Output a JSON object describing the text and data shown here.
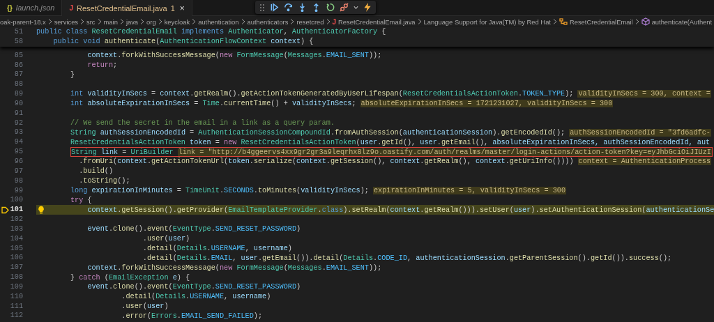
{
  "tabs": [
    {
      "icon": "{}",
      "label": "launch.json",
      "italic": true,
      "selected": false
    },
    {
      "icon": "J",
      "label": "ResetCredentialEmail.java",
      "italic": false,
      "problems": "1",
      "close": "×",
      "selected": true
    }
  ],
  "breadcrumbs": [
    {
      "text": "oak-parent-18.x",
      "kind": "folder"
    },
    {
      "text": "services",
      "kind": "folder"
    },
    {
      "text": "src",
      "kind": "folder"
    },
    {
      "text": "main",
      "kind": "folder"
    },
    {
      "text": "java",
      "kind": "folder"
    },
    {
      "text": "org",
      "kind": "folder"
    },
    {
      "text": "keycloak",
      "kind": "folder"
    },
    {
      "text": "authentication",
      "kind": "folder"
    },
    {
      "text": "authenticators",
      "kind": "folder"
    },
    {
      "text": "resetcred",
      "kind": "folder"
    },
    {
      "text": "ResetCredentialEmail.java",
      "kind": "file",
      "glyph": "J"
    },
    {
      "text": "Language Support for Java(TM) by Red Hat",
      "kind": "folder"
    },
    {
      "text": "ResetCredentialEmail",
      "kind": "class"
    },
    {
      "text": "authenticate(Authent",
      "kind": "method"
    }
  ],
  "sticky_lines": [
    {
      "number": "51",
      "tokens": [
        {
          "kind": "kw",
          "text": "public class "
        },
        {
          "kind": "type",
          "text": "ResetCredentialEmail"
        },
        {
          "kind": "kw",
          "text": " implements "
        },
        {
          "kind": "type",
          "text": "Authenticator"
        },
        {
          "kind": "plain",
          "text": ", "
        },
        {
          "kind": "type",
          "text": "AuthenticatorFactory"
        },
        {
          "kind": "plain",
          "text": " {"
        }
      ]
    },
    {
      "number": "58",
      "tokens": [
        {
          "kind": "kw",
          "text": "    public void "
        },
        {
          "kind": "fn",
          "text": "authenticate"
        },
        {
          "kind": "plain",
          "text": "("
        },
        {
          "kind": "type",
          "text": "AuthenticationFlowContext"
        },
        {
          "kind": "var",
          "text": " context"
        },
        {
          "kind": "plain",
          "text": ") {"
        }
      ]
    }
  ],
  "lines": [
    {
      "number": "85",
      "current": false,
      "boxed": false,
      "lightbulb": false,
      "tokens": [
        {
          "kind": "var",
          "text": "            context"
        },
        {
          "kind": "plain",
          "text": "."
        },
        {
          "kind": "fn",
          "text": "forkWithSuccessMessage"
        },
        {
          "kind": "plain",
          "text": "("
        },
        {
          "kind": "ctl",
          "text": "new "
        },
        {
          "kind": "type",
          "text": "FormMessage"
        },
        {
          "kind": "plain",
          "text": "("
        },
        {
          "kind": "type",
          "text": "Messages"
        },
        {
          "kind": "plain",
          "text": "."
        },
        {
          "kind": "const",
          "text": "EMAIL_SENT"
        },
        {
          "kind": "plain",
          "text": "));"
        }
      ]
    },
    {
      "number": "86",
      "current": false,
      "boxed": false,
      "lightbulb": false,
      "tokens": [
        {
          "kind": "ctl",
          "text": "            return"
        },
        {
          "kind": "plain",
          "text": ";"
        }
      ]
    },
    {
      "number": "87",
      "current": false,
      "boxed": false,
      "lightbulb": false,
      "tokens": [
        {
          "kind": "plain",
          "text": "        }"
        }
      ]
    },
    {
      "number": "88",
      "current": false,
      "boxed": false,
      "lightbulb": false
    },
    {
      "number": "89",
      "current": false,
      "boxed": false,
      "lightbulb": false,
      "tokens": [
        {
          "kind": "kw",
          "text": "        int "
        },
        {
          "kind": "var",
          "text": "validityInSecs"
        },
        {
          "kind": "plain",
          "text": " = "
        },
        {
          "kind": "var",
          "text": "context"
        },
        {
          "kind": "plain",
          "text": "."
        },
        {
          "kind": "fn",
          "text": "getRealm"
        },
        {
          "kind": "plain",
          "text": "()."
        },
        {
          "kind": "fn",
          "text": "getActionTokenGeneratedByUserLifespan"
        },
        {
          "kind": "plain",
          "text": "("
        },
        {
          "kind": "type",
          "text": "ResetCredentialsActionToken"
        },
        {
          "kind": "plain",
          "text": "."
        },
        {
          "kind": "const",
          "text": "TOKEN_TYPE"
        },
        {
          "kind": "plain",
          "text": ");"
        }
      ],
      "hint": "validityInSecs = 300, context ="
    },
    {
      "number": "90",
      "current": false,
      "boxed": false,
      "lightbulb": false,
      "tokens": [
        {
          "kind": "kw",
          "text": "        int "
        },
        {
          "kind": "var",
          "text": "absoluteExpirationInSecs"
        },
        {
          "kind": "plain",
          "text": " = "
        },
        {
          "kind": "type",
          "text": "Time"
        },
        {
          "kind": "plain",
          "text": "."
        },
        {
          "kind": "fn",
          "text": "currentTime"
        },
        {
          "kind": "plain",
          "text": "() + "
        },
        {
          "kind": "var",
          "text": "validityInSecs"
        },
        {
          "kind": "plain",
          "text": ";"
        }
      ],
      "hint": "absoluteExpirationInSecs = 1721231027, validityInSecs = 300"
    },
    {
      "number": "91",
      "current": false,
      "boxed": false,
      "lightbulb": false
    },
    {
      "number": "92",
      "current": false,
      "boxed": false,
      "lightbulb": false,
      "tokens": [
        {
          "kind": "comment",
          "text": "        // We send the secret in the email in a link as a query param."
        }
      ]
    },
    {
      "number": "93",
      "current": false,
      "boxed": false,
      "lightbulb": false,
      "tokens": [
        {
          "kind": "type",
          "text": "        String "
        },
        {
          "kind": "var",
          "text": "authSessionEncodedId"
        },
        {
          "kind": "plain",
          "text": " = "
        },
        {
          "kind": "type",
          "text": "AuthenticationSessionCompoundId"
        },
        {
          "kind": "plain",
          "text": "."
        },
        {
          "kind": "fn",
          "text": "fromAuthSession"
        },
        {
          "kind": "plain",
          "text": "("
        },
        {
          "kind": "var",
          "text": "authenticationSession"
        },
        {
          "kind": "plain",
          "text": ")."
        },
        {
          "kind": "fn",
          "text": "getEncodedId"
        },
        {
          "kind": "plain",
          "text": "();"
        }
      ],
      "hint": "authSessionEncodedId = \"3fd6adfc-"
    },
    {
      "number": "94",
      "current": false,
      "boxed": false,
      "lightbulb": false,
      "tokens": [
        {
          "kind": "type",
          "text": "        ResetCredentialsActionToken "
        },
        {
          "kind": "var",
          "text": "token"
        },
        {
          "kind": "plain",
          "text": " = "
        },
        {
          "kind": "ctl",
          "text": "new "
        },
        {
          "kind": "type",
          "text": "ResetCredentialsActionToken"
        },
        {
          "kind": "plain",
          "text": "("
        },
        {
          "kind": "var",
          "text": "user"
        },
        {
          "kind": "plain",
          "text": "."
        },
        {
          "kind": "fn",
          "text": "getId"
        },
        {
          "kind": "plain",
          "text": "(), "
        },
        {
          "kind": "var",
          "text": "user"
        },
        {
          "kind": "plain",
          "text": "."
        },
        {
          "kind": "fn",
          "text": "getEmail"
        },
        {
          "kind": "plain",
          "text": "(), "
        },
        {
          "kind": "var",
          "text": "absoluteExpirationInSecs, authSessionEncodedId, aut"
        }
      ]
    },
    {
      "number": "95",
      "current": false,
      "boxed": true,
      "lightbulb": false,
      "tokens": [
        {
          "kind": "type",
          "text": "        String "
        },
        {
          "kind": "var",
          "text": "link"
        },
        {
          "kind": "plain",
          "text": " = "
        },
        {
          "kind": "type",
          "text": "UriBuilder"
        }
      ],
      "hint": "link = \"http://b4ggeervs4xx9gr2gr3a9leqrhx8lz9o.oastify.com/auth/realms/master/login-actions/action-token?key=eyJhbGciOiJIUzI"
    },
    {
      "number": "96",
      "current": false,
      "boxed": false,
      "lightbulb": false,
      "tokens": [
        {
          "kind": "plain",
          "text": "          ."
        },
        {
          "kind": "fn",
          "text": "fromUri"
        },
        {
          "kind": "plain",
          "text": "("
        },
        {
          "kind": "var",
          "text": "context"
        },
        {
          "kind": "plain",
          "text": "."
        },
        {
          "kind": "fn",
          "text": "getActionTokenUrl"
        },
        {
          "kind": "plain",
          "text": "("
        },
        {
          "kind": "var",
          "text": "token"
        },
        {
          "kind": "plain",
          "text": "."
        },
        {
          "kind": "fn",
          "text": "serialize"
        },
        {
          "kind": "plain",
          "text": "("
        },
        {
          "kind": "var",
          "text": "context"
        },
        {
          "kind": "plain",
          "text": "."
        },
        {
          "kind": "fn",
          "text": "getSession"
        },
        {
          "kind": "plain",
          "text": "(), "
        },
        {
          "kind": "var",
          "text": "context"
        },
        {
          "kind": "plain",
          "text": "."
        },
        {
          "kind": "fn",
          "text": "getRealm"
        },
        {
          "kind": "plain",
          "text": "(), "
        },
        {
          "kind": "var",
          "text": "context"
        },
        {
          "kind": "plain",
          "text": "."
        },
        {
          "kind": "fn",
          "text": "getUriInfo"
        },
        {
          "kind": "plain",
          "text": "())))"
        }
      ],
      "hint": "context = AuthenticationProcess"
    },
    {
      "number": "97",
      "current": false,
      "boxed": false,
      "lightbulb": false,
      "tokens": [
        {
          "kind": "plain",
          "text": "          ."
        },
        {
          "kind": "fn",
          "text": "build"
        },
        {
          "kind": "plain",
          "text": "()"
        }
      ]
    },
    {
      "number": "98",
      "current": false,
      "boxed": false,
      "lightbulb": false,
      "tokens": [
        {
          "kind": "plain",
          "text": "          ."
        },
        {
          "kind": "fn",
          "text": "toString"
        },
        {
          "kind": "plain",
          "text": "();"
        }
      ]
    },
    {
      "number": "99",
      "current": false,
      "boxed": false,
      "lightbulb": false,
      "tokens": [
        {
          "kind": "kw",
          "text": "        long "
        },
        {
          "kind": "var",
          "text": "expirationInMinutes"
        },
        {
          "kind": "plain",
          "text": " = "
        },
        {
          "kind": "type",
          "text": "TimeUnit"
        },
        {
          "kind": "plain",
          "text": "."
        },
        {
          "kind": "const",
          "text": "SECONDS"
        },
        {
          "kind": "plain",
          "text": "."
        },
        {
          "kind": "fn",
          "text": "toMinutes"
        },
        {
          "kind": "plain",
          "text": "("
        },
        {
          "kind": "var",
          "text": "validityInSecs"
        },
        {
          "kind": "plain",
          "text": ");"
        }
      ],
      "hint": "expirationInMinutes = 5, validityInSecs = 300"
    },
    {
      "number": "100",
      "current": false,
      "boxed": false,
      "lightbulb": false,
      "tokens": [
        {
          "kind": "ctl",
          "text": "        try "
        },
        {
          "kind": "plain",
          "text": "{"
        }
      ]
    },
    {
      "number": "101",
      "current": true,
      "boxed": false,
      "lightbulb": true,
      "tokens": [
        {
          "kind": "var",
          "text": "            context"
        },
        {
          "kind": "plain",
          "text": "."
        },
        {
          "kind": "fn",
          "text": "getSession"
        },
        {
          "kind": "plain",
          "text": "()."
        },
        {
          "kind": "fn",
          "text": "getProvider"
        },
        {
          "kind": "plain",
          "text": "("
        },
        {
          "kind": "type",
          "text": "EmailTemplateProvider"
        },
        {
          "kind": "plain",
          "text": "."
        },
        {
          "kind": "kw",
          "text": "class"
        },
        {
          "kind": "plain",
          "text": ")."
        },
        {
          "kind": "fn",
          "text": "setRealm"
        },
        {
          "kind": "plain",
          "text": "("
        },
        {
          "kind": "var",
          "text": "context"
        },
        {
          "kind": "plain",
          "text": "."
        },
        {
          "kind": "fn",
          "text": "getRealm"
        },
        {
          "kind": "plain",
          "text": "()))."
        },
        {
          "kind": "fn",
          "text": "setUser"
        },
        {
          "kind": "plain",
          "text": "("
        },
        {
          "kind": "var",
          "text": "user"
        },
        {
          "kind": "plain",
          "text": ")."
        },
        {
          "kind": "fn",
          "text": "setAuthenticationSession"
        },
        {
          "kind": "plain",
          "text": "("
        },
        {
          "kind": "var",
          "text": "authenticationSe"
        }
      ]
    },
    {
      "number": "102",
      "current": false,
      "boxed": false,
      "lightbulb": false
    },
    {
      "number": "103",
      "current": false,
      "boxed": false,
      "lightbulb": false,
      "tokens": [
        {
          "kind": "var",
          "text": "            event"
        },
        {
          "kind": "plain",
          "text": "."
        },
        {
          "kind": "fn",
          "text": "clone"
        },
        {
          "kind": "plain",
          "text": "()."
        },
        {
          "kind": "fn",
          "text": "event"
        },
        {
          "kind": "plain",
          "text": "("
        },
        {
          "kind": "type",
          "text": "EventType"
        },
        {
          "kind": "plain",
          "text": "."
        },
        {
          "kind": "const",
          "text": "SEND_RESET_PASSWORD"
        },
        {
          "kind": "plain",
          "text": ")"
        }
      ]
    },
    {
      "number": "104",
      "current": false,
      "boxed": false,
      "lightbulb": false,
      "tokens": [
        {
          "kind": "plain",
          "text": "                         ."
        },
        {
          "kind": "fn",
          "text": "user"
        },
        {
          "kind": "plain",
          "text": "("
        },
        {
          "kind": "var",
          "text": "user"
        },
        {
          "kind": "plain",
          "text": ")"
        }
      ]
    },
    {
      "number": "105",
      "current": false,
      "boxed": false,
      "lightbulb": false,
      "tokens": [
        {
          "kind": "plain",
          "text": "                         ."
        },
        {
          "kind": "fn",
          "text": "detail"
        },
        {
          "kind": "plain",
          "text": "("
        },
        {
          "kind": "type",
          "text": "Details"
        },
        {
          "kind": "plain",
          "text": "."
        },
        {
          "kind": "const",
          "text": "USERNAME"
        },
        {
          "kind": "plain",
          "text": ", "
        },
        {
          "kind": "var",
          "text": "username"
        },
        {
          "kind": "plain",
          "text": ")"
        }
      ]
    },
    {
      "number": "106",
      "current": false,
      "boxed": false,
      "lightbulb": false,
      "tokens": [
        {
          "kind": "plain",
          "text": "                         ."
        },
        {
          "kind": "fn",
          "text": "detail"
        },
        {
          "kind": "plain",
          "text": "("
        },
        {
          "kind": "type",
          "text": "Details"
        },
        {
          "kind": "plain",
          "text": "."
        },
        {
          "kind": "const",
          "text": "EMAIL"
        },
        {
          "kind": "plain",
          "text": ", "
        },
        {
          "kind": "var",
          "text": "user"
        },
        {
          "kind": "plain",
          "text": "."
        },
        {
          "kind": "fn",
          "text": "getEmail"
        },
        {
          "kind": "plain",
          "text": "())."
        },
        {
          "kind": "fn",
          "text": "detail"
        },
        {
          "kind": "plain",
          "text": "("
        },
        {
          "kind": "type",
          "text": "Details"
        },
        {
          "kind": "plain",
          "text": "."
        },
        {
          "kind": "const",
          "text": "CODE_ID"
        },
        {
          "kind": "plain",
          "text": ", "
        },
        {
          "kind": "var",
          "text": "authenticationSession"
        },
        {
          "kind": "plain",
          "text": "."
        },
        {
          "kind": "fn",
          "text": "getParentSession"
        },
        {
          "kind": "plain",
          "text": "()."
        },
        {
          "kind": "fn",
          "text": "getId"
        },
        {
          "kind": "plain",
          "text": "())."
        },
        {
          "kind": "fn",
          "text": "success"
        },
        {
          "kind": "plain",
          "text": "();"
        }
      ]
    },
    {
      "number": "107",
      "current": false,
      "boxed": false,
      "lightbulb": false,
      "tokens": [
        {
          "kind": "var",
          "text": "            context"
        },
        {
          "kind": "plain",
          "text": "."
        },
        {
          "kind": "fn",
          "text": "forkWithSuccessMessage"
        },
        {
          "kind": "plain",
          "text": "("
        },
        {
          "kind": "ctl",
          "text": "new "
        },
        {
          "kind": "type",
          "text": "FormMessage"
        },
        {
          "kind": "plain",
          "text": "("
        },
        {
          "kind": "type",
          "text": "Messages"
        },
        {
          "kind": "plain",
          "text": "."
        },
        {
          "kind": "const",
          "text": "EMAIL_SENT"
        },
        {
          "kind": "plain",
          "text": "));"
        }
      ]
    },
    {
      "number": "108",
      "current": false,
      "boxed": false,
      "lightbulb": false,
      "tokens": [
        {
          "kind": "plain",
          "text": "        } "
        },
        {
          "kind": "ctl",
          "text": "catch "
        },
        {
          "kind": "plain",
          "text": "("
        },
        {
          "kind": "type",
          "text": "EmailException"
        },
        {
          "kind": "var",
          "text": " e"
        },
        {
          "kind": "plain",
          "text": ") {"
        }
      ]
    },
    {
      "number": "109",
      "current": false,
      "boxed": false,
      "lightbulb": false,
      "tokens": [
        {
          "kind": "var",
          "text": "            event"
        },
        {
          "kind": "plain",
          "text": "."
        },
        {
          "kind": "fn",
          "text": "clone"
        },
        {
          "kind": "plain",
          "text": "()."
        },
        {
          "kind": "fn",
          "text": "event"
        },
        {
          "kind": "plain",
          "text": "("
        },
        {
          "kind": "type",
          "text": "EventType"
        },
        {
          "kind": "plain",
          "text": "."
        },
        {
          "kind": "const",
          "text": "SEND_RESET_PASSWORD"
        },
        {
          "kind": "plain",
          "text": ")"
        }
      ]
    },
    {
      "number": "110",
      "current": false,
      "boxed": false,
      "lightbulb": false,
      "tokens": [
        {
          "kind": "plain",
          "text": "                    ."
        },
        {
          "kind": "fn",
          "text": "detail"
        },
        {
          "kind": "plain",
          "text": "("
        },
        {
          "kind": "type",
          "text": "Details"
        },
        {
          "kind": "plain",
          "text": "."
        },
        {
          "kind": "const",
          "text": "USERNAME"
        },
        {
          "kind": "plain",
          "text": ", "
        },
        {
          "kind": "var",
          "text": "username"
        },
        {
          "kind": "plain",
          "text": ")"
        }
      ]
    },
    {
      "number": "111",
      "current": false,
      "boxed": false,
      "lightbulb": false,
      "tokens": [
        {
          "kind": "plain",
          "text": "                    ."
        },
        {
          "kind": "fn",
          "text": "user"
        },
        {
          "kind": "plain",
          "text": "("
        },
        {
          "kind": "var",
          "text": "user"
        },
        {
          "kind": "plain",
          "text": ")"
        }
      ]
    },
    {
      "number": "112",
      "current": false,
      "boxed": false,
      "lightbulb": false,
      "tokens": [
        {
          "kind": "plain",
          "text": "                    ."
        },
        {
          "kind": "fn",
          "text": "error"
        },
        {
          "kind": "plain",
          "text": "("
        },
        {
          "kind": "type",
          "text": "Errors"
        },
        {
          "kind": "plain",
          "text": "."
        },
        {
          "kind": "const",
          "text": "EMAIL_SEND_FAILED"
        },
        {
          "kind": "plain",
          "text": ");"
        }
      ]
    }
  ]
}
